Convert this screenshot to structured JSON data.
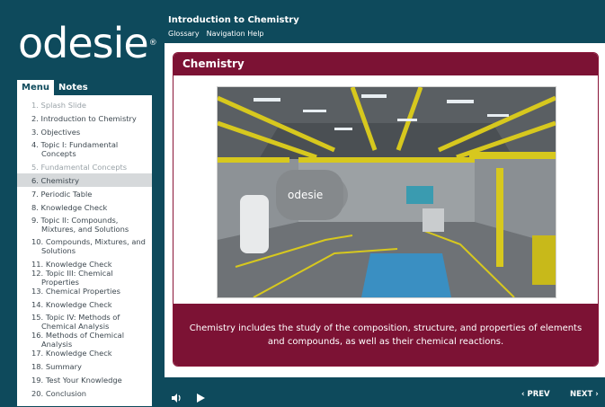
{
  "brand": {
    "name": "odesie",
    "registered_mark": "®"
  },
  "tabs": {
    "menu": "Menu",
    "notes": "Notes"
  },
  "header": {
    "title": "Introduction to Chemistry",
    "links": [
      "Glossary",
      "Navigation Help"
    ]
  },
  "menu_items": [
    "1. Splash Slide",
    "2. Introduction to Chemistry",
    "3. Objectives",
    "4. Topic I: Fundamental Concepts",
    "5. Fundamental Concepts",
    "6. Chemistry",
    "7. Periodic Table",
    "8. Knowledge Check",
    "9. Topic II: Compounds, Mixtures, and Solutions",
    "10. Compounds, Mixtures, and Solutions",
    "11. Knowledge Check",
    "12. Topic III: Chemical Properties",
    "13. Chemical Properties",
    "14. Knowledge Check",
    "15. Topic IV: Methods of Chemical Analysis",
    "16. Methods of Chemical Analysis",
    "17. Knowledge Check",
    "18. Summary",
    "19. Test Your Knowledge",
    "20. Conclusion"
  ],
  "slide": {
    "heading": "Chemistry",
    "image_label": "odesie",
    "caption": "Chemistry includes the study of the composition, structure, and properties of elements and compounds, as well as their chemical reactions."
  },
  "controls": {
    "audio_icon": "speaker-icon",
    "play_icon": "play-icon",
    "prev": "‹ PREV",
    "next": "NEXT ›"
  },
  "colors": {
    "frame": "#0e4a5c",
    "panel_accent": "#7c1234",
    "active_menu_item": "#d6d9db"
  }
}
